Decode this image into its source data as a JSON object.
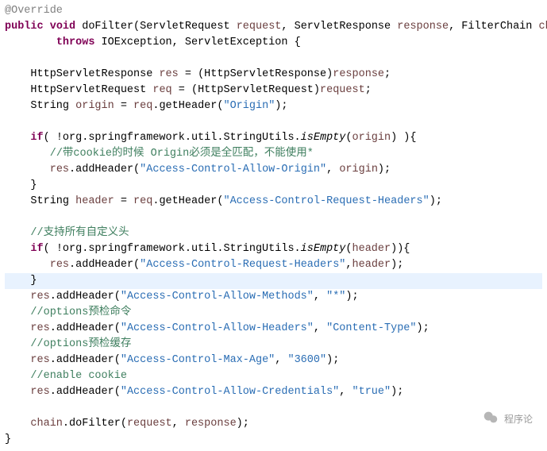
{
  "annotation": "@Override",
  "kw": {
    "public": "public",
    "void": "void",
    "throws": "throws",
    "if": "if"
  },
  "method_name": "doFilter",
  "sig": {
    "t_req": "ServletRequest",
    "p_req": "request",
    "t_res": "ServletResponse",
    "p_res": "response",
    "t_chain": "FilterChain",
    "p_chain": "chain",
    "ex1": "IOException",
    "ex2": "ServletException"
  },
  "decl": {
    "t_httpres": "HttpServletResponse",
    "v_res": "res",
    "cast_res": "(HttpServletResponse)",
    "v_response": "response",
    "t_httpreq": "HttpServletRequest",
    "v_req": "req",
    "cast_req": "(HttpServletRequest)",
    "v_request": "request",
    "t_string": "String",
    "v_origin": "origin",
    "getHeader": ".getHeader(",
    "str_origin": "\"Origin\"",
    "v_header": "header",
    "str_acrh": "\"Access-Control-Request-Headers\""
  },
  "util": {
    "prefix": "!org.springframework.util.StringUtils.",
    "isEmpty": "isEmpty"
  },
  "comments": {
    "cookie_origin": "//带cookie的时候 Origin必须是全匹配，不能使用*",
    "all_custom": "//支持所有自定义头",
    "options_preflight": "//options预检命令",
    "options_cache": "//options预检缓存",
    "enable_cookie": "//enable cookie"
  },
  "calls": {
    "addHeader": ".addHeader(",
    "doFilter": ".doFilter("
  },
  "strings": {
    "acao": "\"Access-Control-Allow-Origin\"",
    "acrh": "\"Access-Control-Request-Headers\"",
    "acam": "\"Access-Control-Allow-Methods\"",
    "star": "\"*\"",
    "acah": "\"Access-Control-Allow-Headers\"",
    "ctype": "\"Content-Type\"",
    "maxage": "\"Access-Control-Max-Age\"",
    "num3600": "\"3600\"",
    "acac": "\"Access-Control-Allow-Credentials\"",
    "true_s": "\"true\""
  },
  "chain_var": "chain",
  "watermark_text": "程序论"
}
